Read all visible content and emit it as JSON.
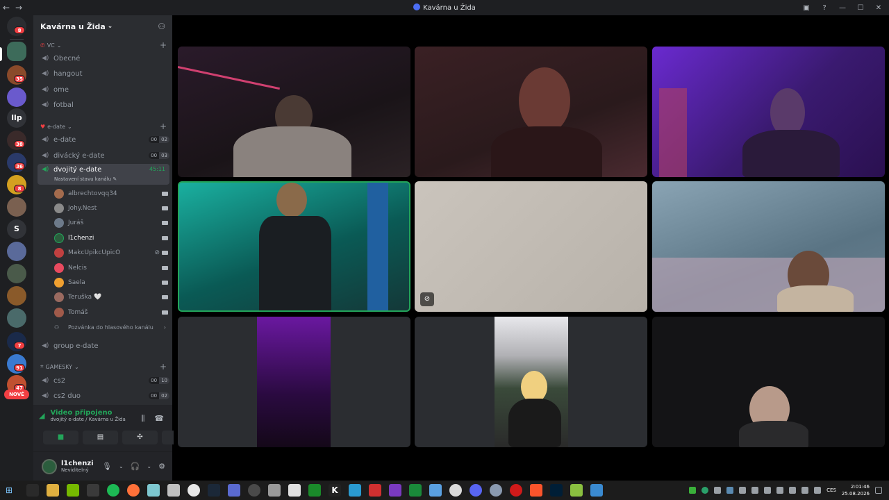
{
  "window": {
    "title": "Kavárna u Žida",
    "back": "←",
    "forward": "→"
  },
  "server": {
    "name": "Kavárna u Žida",
    "rail_badges": [
      "8",
      "35",
      "38",
      "36",
      "8",
      "7",
      "91",
      "47"
    ],
    "rail_text_icons": [
      "llp",
      "S"
    ],
    "new_label": "NOVÉ"
  },
  "categories": [
    {
      "name": "VC"
    },
    {
      "name": "e-date"
    },
    {
      "name": "GAMESKY"
    }
  ],
  "channels": {
    "vc": [
      "Obecné",
      "hangout",
      "ome",
      "fotbal"
    ],
    "edate": [
      {
        "name": "e-date",
        "count_a": "00",
        "count_b": "02"
      },
      {
        "name": "divácký e-date",
        "count_a": "00",
        "count_b": "03"
      }
    ],
    "active": {
      "name": "dvojitý e-date",
      "timer": "45:11",
      "status": "Nastavení stavu kanálu"
    },
    "after_active": {
      "name": "group e-date"
    },
    "gamesky": [
      {
        "name": "cs2",
        "count_a": "00",
        "count_b": "10"
      },
      {
        "name": "cs2 duo",
        "count_a": "00",
        "count_b": "02"
      }
    ]
  },
  "members": [
    {
      "name": "albrechtovqq34",
      "color": "#a36b4d"
    },
    {
      "name": "Johy.Nest",
      "color": "#8a8a8a"
    },
    {
      "name": "Juráš",
      "color": "#6d7a8a"
    },
    {
      "name": "l1chenzi",
      "color": "#2b5d3d"
    },
    {
      "name": "MakcUpikcUpicO",
      "color": "#c04040"
    },
    {
      "name": "Nelcis",
      "color": "#e84a5f"
    },
    {
      "name": "Saela",
      "color": "#f0a030"
    },
    {
      "name": "Teruška 🤍",
      "color": "#9a6a60"
    },
    {
      "name": "Tomáš",
      "color": "#a05a4a"
    }
  ],
  "invite_label": "Pozvánka do hlasového kanálu",
  "voice": {
    "title": "Video připojeno",
    "subtitle": "dvojitý e-date / Kavárna u Žida"
  },
  "user": {
    "name": "l1chenzi",
    "status": "Neviditelný"
  },
  "taskbar": {
    "lang": "CES",
    "time": "2:01:46",
    "date": "25.08.2026"
  }
}
